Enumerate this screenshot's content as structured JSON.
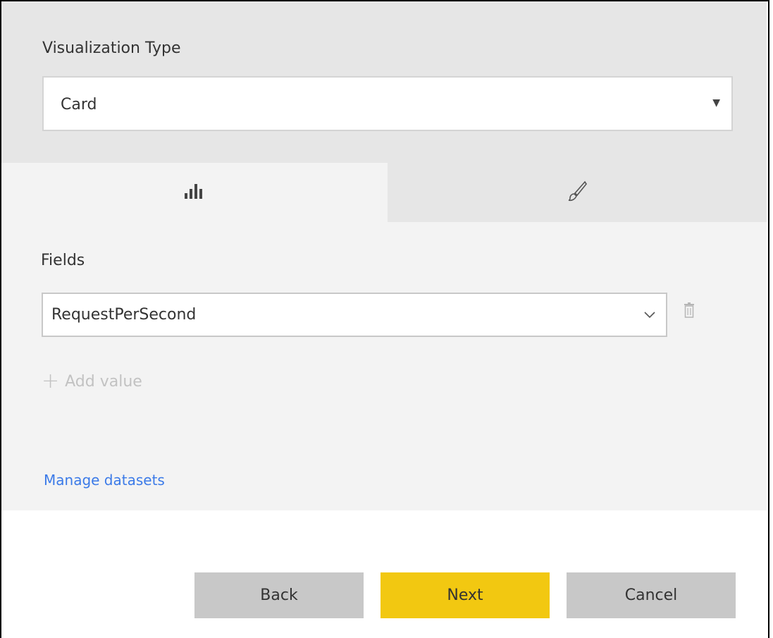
{
  "visualization": {
    "label": "Visualization Type",
    "selected": "Card"
  },
  "tabs": [
    {
      "icon": "bar-chart-icon",
      "active": true
    },
    {
      "icon": "paintbrush-icon",
      "active": false
    }
  ],
  "fields": {
    "label": "Fields",
    "selected": "RequestPerSecond",
    "add_value_label": "Add value"
  },
  "links": {
    "manage_datasets": "Manage datasets"
  },
  "buttons": {
    "back": "Back",
    "next": "Next",
    "cancel": "Cancel"
  },
  "colors": {
    "accent_yellow": "#f2c811",
    "link_blue": "#3b7ae8",
    "panel_gray": "#f3f3f3",
    "header_gray": "#e6e6e6"
  }
}
